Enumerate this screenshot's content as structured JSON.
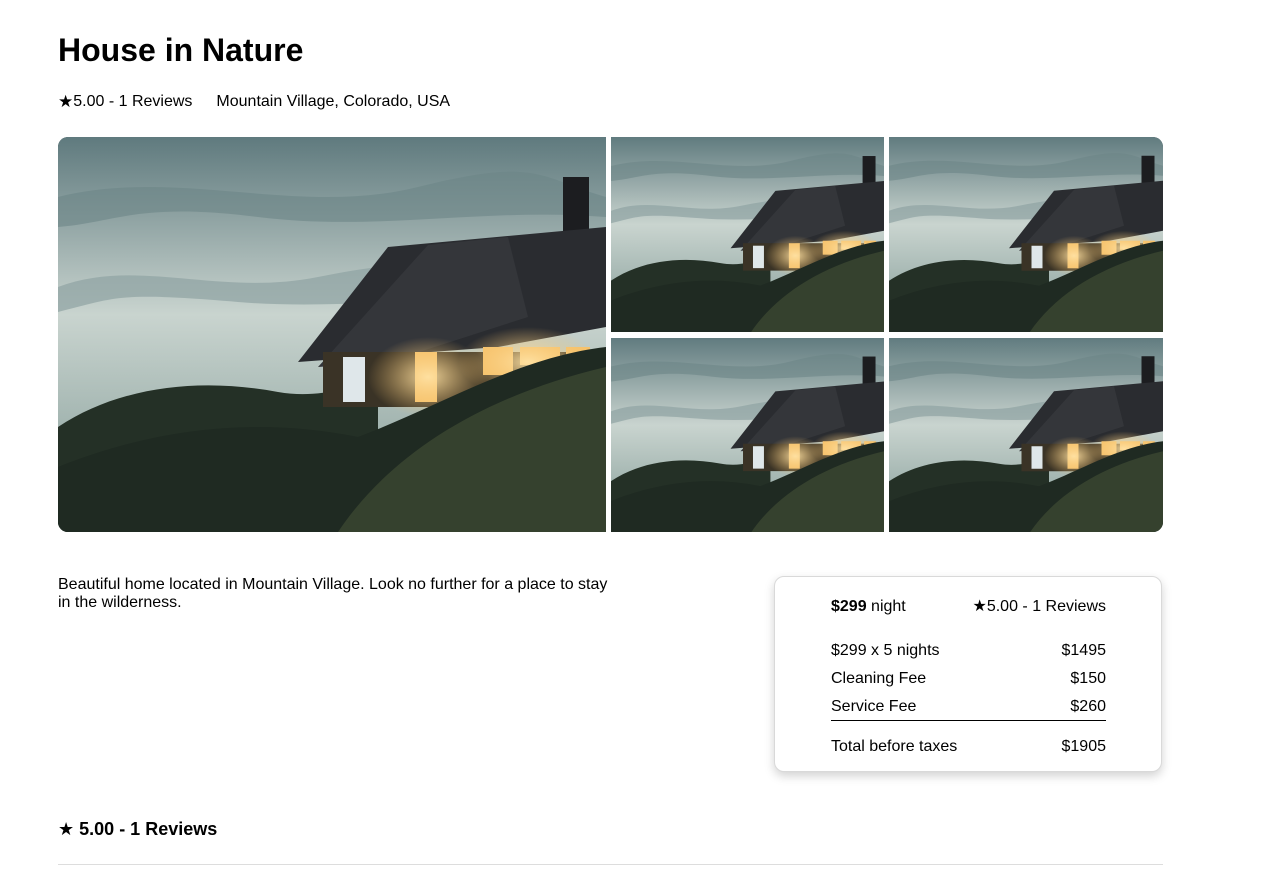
{
  "listing": {
    "title": "House in Nature",
    "rating_summary": "5.00 - 1 Reviews",
    "location": "Mountain Village, Colorado, USA",
    "description": "Beautiful home located in Mountain Village. Look no further for a place to stay in the wilderness."
  },
  "icons": {
    "star": "★"
  },
  "booking": {
    "price": "$299",
    "unit": "night",
    "rating_summary": "5.00 - 1 Reviews",
    "lines": [
      {
        "label": "$299 x 5 nights",
        "value": "$1495"
      },
      {
        "label": "Cleaning Fee",
        "value": "$150"
      },
      {
        "label": "Service Fee",
        "value": "$260"
      }
    ],
    "total": {
      "label": "Total before taxes",
      "value": "$1905"
    }
  },
  "reviews": {
    "heading": "5.00 - 1 Reviews"
  },
  "colors": {
    "sky_top": "#5f7a7e",
    "sky_light": "#c9d4cf",
    "hill": "#1f2a22",
    "roof": "#2a2c30",
    "window_glow": "#f6c26b"
  }
}
